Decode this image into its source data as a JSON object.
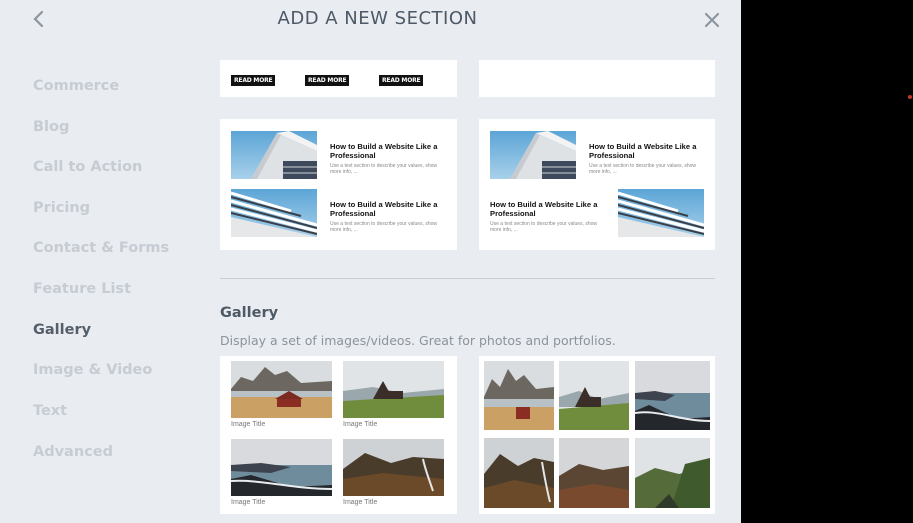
{
  "header": {
    "title": "ADD A NEW SECTION"
  },
  "icons": {
    "back": "chevron-left-icon",
    "close": "close-icon"
  },
  "sidebar": {
    "items": [
      {
        "label": "Commerce"
      },
      {
        "label": "Blog"
      },
      {
        "label": "Call to Action"
      },
      {
        "label": "Pricing"
      },
      {
        "label": "Contact & Forms"
      },
      {
        "label": "Feature List"
      },
      {
        "label": "Gallery",
        "active": true
      },
      {
        "label": "Image & Video"
      },
      {
        "label": "Text"
      },
      {
        "label": "Advanced"
      }
    ]
  },
  "blog_cards": {
    "read_more": "READ MORE",
    "post_title": "How to Build a Website Like a Professional",
    "post_desc": "Use a text section to describe your values, show more info, ..."
  },
  "gallery": {
    "heading": "Gallery",
    "description": "Display a set of images/videos. Great for photos and portfolios.",
    "image_title": "Image Title"
  },
  "colors": {
    "panel_bg": "#e9ecf0",
    "nav_inactive": "#c6ccd3",
    "nav_active": "#555f6a",
    "heading": "#4d5966"
  }
}
